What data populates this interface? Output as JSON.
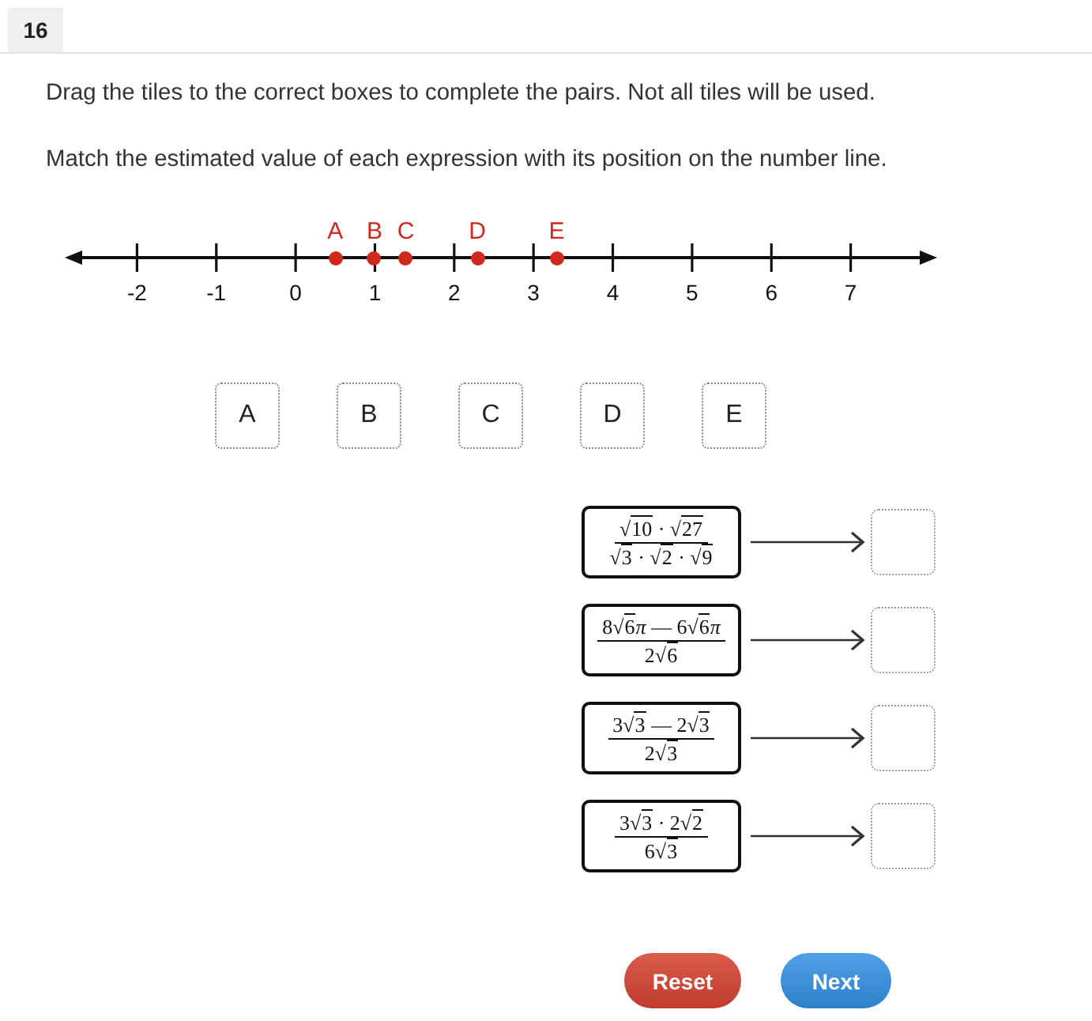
{
  "question_number": "16",
  "instructions": [
    "Drag the tiles to the correct boxes to complete the pairs. Not all tiles will be used.",
    "Match the estimated value of each expression with its position on the number line."
  ],
  "number_line": {
    "tick_labels": [
      "-2",
      "-1",
      "0",
      "1",
      "2",
      "3",
      "4",
      "5",
      "6",
      "7"
    ],
    "points": [
      {
        "label": "A",
        "level": 0.31
      },
      {
        "label": "B",
        "level": 0.355
      },
      {
        "label": "C",
        "level": 0.391
      },
      {
        "label": "D",
        "level": 0.473
      },
      {
        "label": "E",
        "level": 0.564
      }
    ]
  },
  "tiles": [
    "A",
    "B",
    "C",
    "D",
    "E"
  ],
  "pairs": [
    {
      "numerator": [
        {
          "kind": "text",
          "text": "√"
        },
        {
          "kind": "radicand",
          "text": "10"
        },
        {
          "kind": "text",
          "text": " · √"
        },
        {
          "kind": "radicand",
          "text": "27"
        }
      ],
      "denominator": [
        {
          "kind": "text",
          "text": "√"
        },
        {
          "kind": "radicand",
          "text": "3"
        },
        {
          "kind": "text",
          "text": " · √"
        },
        {
          "kind": "radicand",
          "text": "2"
        },
        {
          "kind": "text",
          "text": " · √"
        },
        {
          "kind": "radicand",
          "text": "9"
        }
      ]
    },
    {
      "numerator": [
        {
          "kind": "text",
          "text": "8√"
        },
        {
          "kind": "radicand",
          "text": "6"
        },
        {
          "kind": "text",
          "text": "*π* — 6√"
        },
        {
          "kind": "radicand",
          "text": "6"
        },
        {
          "kind": "text",
          "text": "*π*"
        }
      ],
      "denominator": [
        {
          "kind": "text",
          "text": "2√"
        },
        {
          "kind": "radicand",
          "text": "6"
        }
      ]
    },
    {
      "numerator": [
        {
          "kind": "text",
          "text": "3√"
        },
        {
          "kind": "radicand",
          "text": "3"
        },
        {
          "kind": "text",
          "text": " — 2√"
        },
        {
          "kind": "radicand",
          "text": "3"
        }
      ],
      "denominator": [
        {
          "kind": "text",
          "text": "2√"
        },
        {
          "kind": "radicand",
          "text": "3"
        }
      ]
    },
    {
      "numerator": [
        {
          "kind": "text",
          "text": "3√"
        },
        {
          "kind": "radicand",
          "text": "3"
        },
        {
          "kind": "text",
          "text": " · 2√"
        },
        {
          "kind": "radicand",
          "text": "2"
        }
      ],
      "denominator": [
        {
          "kind": "text",
          "text": "6√"
        },
        {
          "kind": "radicand",
          "text": "3"
        }
      ]
    }
  ],
  "buttons": [
    {
      "label": "Reset",
      "kind": "reset"
    },
    {
      "label": "Next",
      "kind": "next"
    }
  ]
}
